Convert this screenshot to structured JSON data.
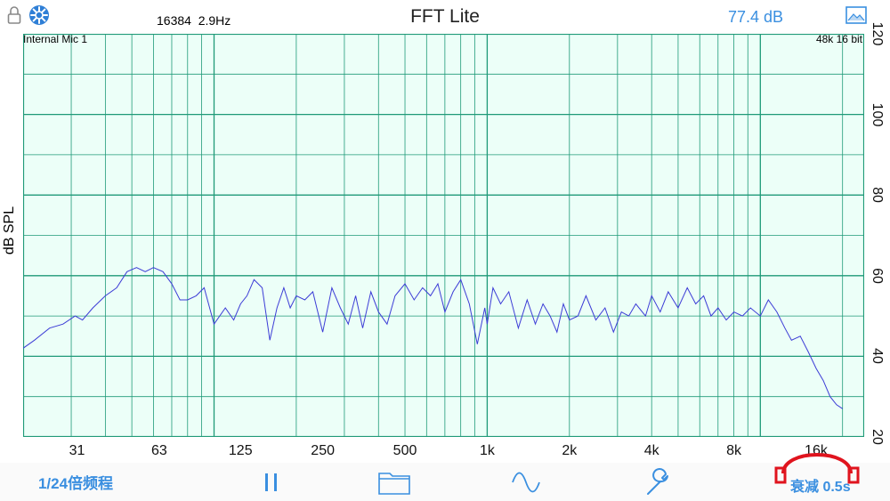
{
  "header": {
    "fft_size": "16384",
    "resolution": "2.9Hz",
    "title": "FFT Lite",
    "level": "77.4 dB"
  },
  "plot": {
    "input_label": "Internal Mic 1",
    "sample_format": "48k 16 bit",
    "y_axis_label": "dB SPL",
    "y_ticks": [
      "120",
      "100",
      "80",
      "60",
      "40",
      "20"
    ],
    "x_ticks": [
      "31",
      "63",
      "125",
      "250",
      "500",
      "1k",
      "2k",
      "4k",
      "8k",
      "16k"
    ]
  },
  "toolbar": {
    "resolution_label": "1/24倍频程",
    "pause_icon": "pause-icon",
    "folder_icon": "folder-icon",
    "wave_icon": "sine-wave-icon",
    "settings_icon": "wrench-icon",
    "decay_label": "衰减 0.5s"
  },
  "colors": {
    "accent": "#3a8fe0",
    "grid": "#1f9a78",
    "plot_bg": "#ecfff8",
    "trace": "#3c3cd6"
  },
  "chart_data": {
    "type": "line",
    "title": "",
    "xlabel": "",
    "ylabel": "dB SPL",
    "x_scale": "log",
    "ylim": [
      20,
      120
    ],
    "grid": true,
    "series": [
      {
        "x": [
          20,
          22,
          25,
          28,
          31,
          33,
          36,
          40,
          44,
          48,
          52,
          56,
          60,
          65,
          70,
          75,
          80,
          86,
          92,
          100,
          110,
          118,
          125,
          132,
          140,
          150,
          160,
          170,
          180,
          190,
          200,
          215,
          230,
          250,
          270,
          290,
          310,
          330,
          350,
          375,
          400,
          430,
          460,
          500,
          540,
          580,
          620,
          660,
          700,
          750,
          800,
          860,
          920,
          980,
          1000,
          1050,
          1120,
          1200,
          1300,
          1400,
          1500,
          1600,
          1700,
          1800,
          1900,
          2000,
          2150,
          2300,
          2500,
          2700,
          2900,
          3100,
          3300,
          3500,
          3800,
          4000,
          4300,
          4600,
          5000,
          5400,
          5800,
          6200,
          6600,
          7000,
          7500,
          8000,
          8600,
          9200,
          10000,
          10700,
          11500,
          12300,
          13000,
          14000,
          15000,
          16000,
          17000,
          18000,
          19000,
          20000
        ],
        "y": [
          42,
          44,
          47,
          48,
          50,
          49,
          52,
          55,
          57,
          61,
          62,
          61,
          62,
          61,
          58,
          54,
          54,
          55,
          57,
          48,
          52,
          49,
          53,
          55,
          59,
          57,
          44,
          52,
          57,
          52,
          55,
          54,
          56,
          46,
          57,
          52,
          48,
          55,
          47,
          56,
          51,
          48,
          55,
          58,
          54,
          57,
          55,
          58,
          51,
          56,
          59,
          53,
          43,
          52,
          48,
          57,
          53,
          56,
          47,
          54,
          48,
          53,
          50,
          46,
          53,
          49,
          50,
          55,
          49,
          52,
          46,
          51,
          50,
          53,
          50,
          55,
          51,
          56,
          52,
          57,
          53,
          55,
          50,
          52,
          49,
          51,
          50,
          52,
          50,
          54,
          51,
          47,
          44,
          45,
          41,
          37,
          34,
          30,
          28,
          27
        ]
      }
    ]
  }
}
